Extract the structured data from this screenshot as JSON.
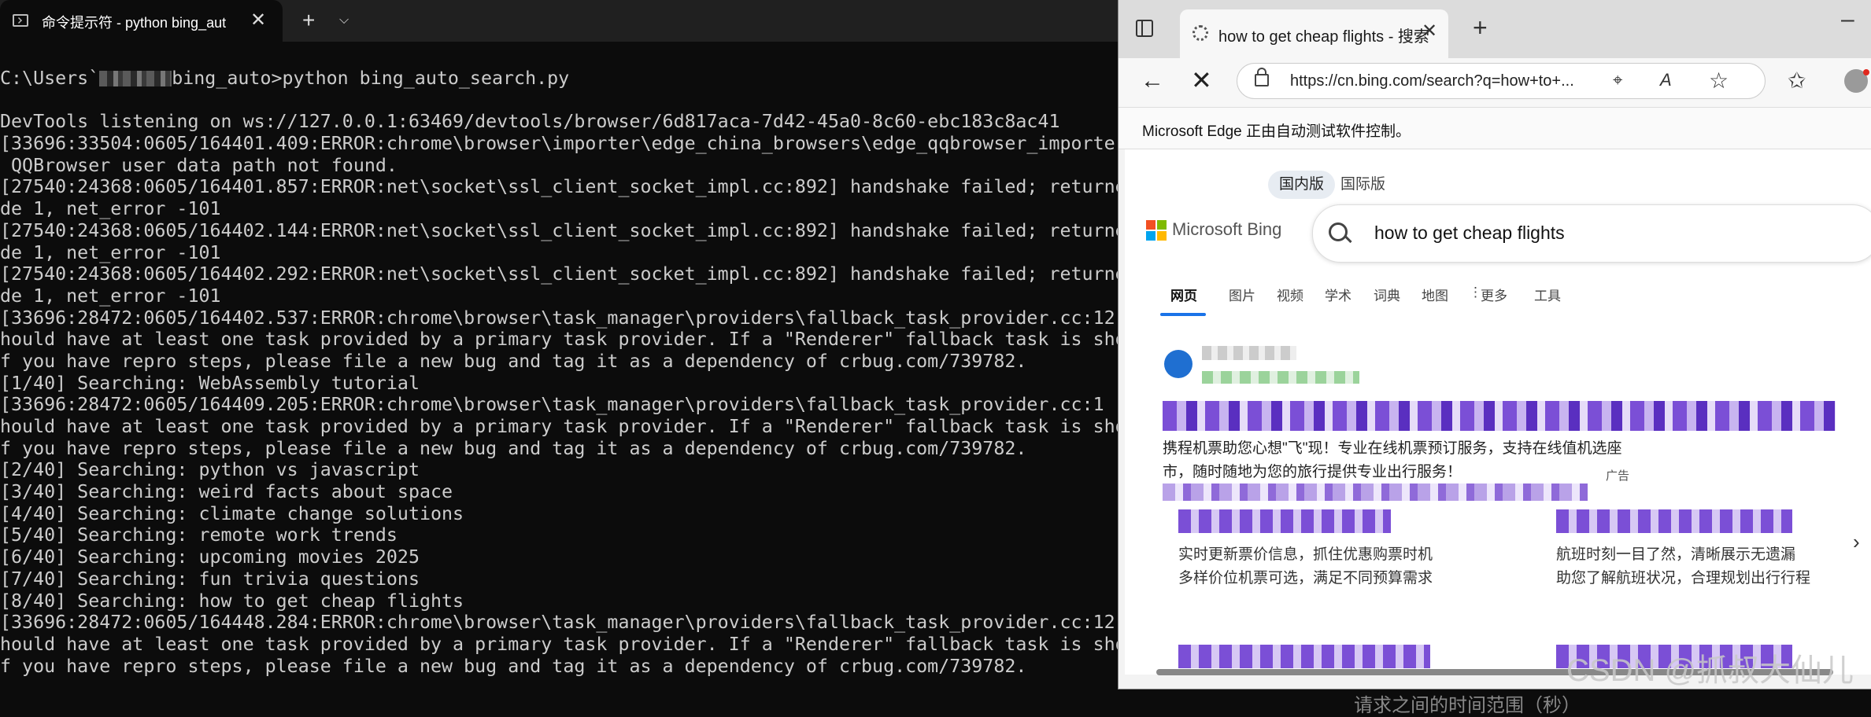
{
  "terminal": {
    "tab_title": "命令提示符 - python  bing_aut",
    "prompt_prefix": "C:\\Users`",
    "prompt_suffix": "bing_auto>python bing_auto_search.py",
    "lines": [
      "DevTools listening on ws://127.0.0.1:63469/devtools/browser/6d817aca-7d42-45a0-8c60-ebc183c8ac41",
      "[33696:33504:0605/164401.409:ERROR:chrome\\browser\\importer\\edge_china_browsers\\edge_qqbrowser_importer",
      " QQBrowser user data path not found.",
      "[27540:24368:0605/164401.857:ERROR:net\\socket\\ssl_client_socket_impl.cc:892] handshake failed; returne",
      "de 1, net_error -101",
      "[27540:24368:0605/164402.144:ERROR:net\\socket\\ssl_client_socket_impl.cc:892] handshake failed; returne",
      "de 1, net_error -101",
      "[27540:24368:0605/164402.292:ERROR:net\\socket\\ssl_client_socket_impl.cc:892] handshake failed; returne",
      "de 1, net_error -101",
      "[33696:28472:0605/164402.537:ERROR:chrome\\browser\\task_manager\\providers\\fallback_task_provider.cc:12",
      "hould have at least one task provided by a primary task provider. If a \"Renderer\" fallback task is sho",
      "f you have repro steps, please file a new bug and tag it as a dependency of crbug.com/739782.",
      "[1/40] Searching: WebAssembly tutorial",
      "[33696:28472:0605/164409.205:ERROR:chrome\\browser\\task_manager\\providers\\fallback_task_provider.cc:1",
      "hould have at least one task provided by a primary task provider. If a \"Renderer\" fallback task is sho",
      "f you have repro steps, please file a new bug and tag it as a dependency of crbug.com/739782.",
      "[2/40] Searching: python vs javascript",
      "[3/40] Searching: weird facts about space",
      "[4/40] Searching: climate change solutions",
      "[5/40] Searching: remote work trends",
      "[6/40] Searching: upcoming movies 2025",
      "[7/40] Searching: fun trivia questions",
      "[8/40] Searching: how to get cheap flights",
      "[33696:28472:0605/164448.284:ERROR:chrome\\browser\\task_manager\\providers\\fallback_task_provider.cc:12",
      "hould have at least one task provided by a primary task provider. If a \"Renderer\" fallback task is sho",
      "f you have repro steps, please file a new bug and tag it as a dependency of crbug.com/739782."
    ]
  },
  "browser": {
    "tab_title": "how to get cheap flights - 搜索",
    "url": "https://cn.bing.com/search?q=how+to+...",
    "infobar": "Microsoft Edge 正由自动测试软件控制。",
    "market_tabs": [
      "国内版",
      "国际版"
    ],
    "brand": "Microsoft Bing",
    "query": "how to get cheap flights",
    "scopes": [
      "网页",
      "图片",
      "视频",
      "学术",
      "词典",
      "地图",
      "更多",
      "工具"
    ],
    "result": {
      "desc_line1": "携程机票助您心想\"飞\"现！专业在线机票预订服务，支持在线值机选座",
      "desc_line2": "市，随时随地为您的旅行提供专业出行服务！",
      "ad_label": "广告",
      "card1_lines": [
        "实时更新票价信息，抓住优惠购票时机",
        "多样价位机票可选，满足不同预算需求"
      ],
      "card2_lines": [
        "航班时刻一目了然，清晰展示无遗漏",
        "助您了解航班状况，合理规划出行行程"
      ]
    }
  },
  "overlay": {
    "watermark": "CSDN @抓叔大仙儿",
    "under_text": "请求之间的时间范围（秒）"
  },
  "colors": {
    "terminal_bg": "#0c0c0c",
    "terminal_text": "#cccccc",
    "bing_accent": "#1a73e8",
    "blur_purple": "#7b4fd6"
  }
}
